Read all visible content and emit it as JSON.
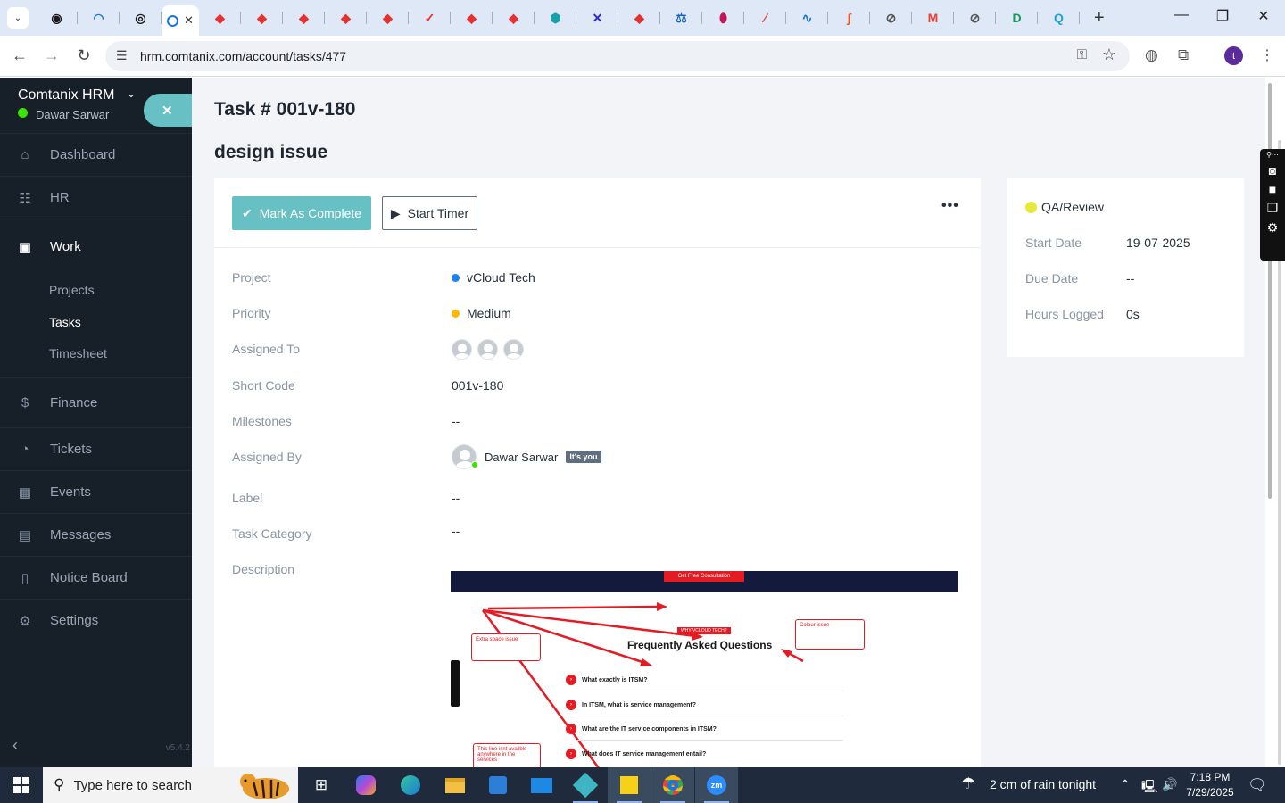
{
  "browser": {
    "url": "hrm.comtanix.com/account/tasks/477",
    "profile_initial": "t",
    "tabs": [
      {
        "color": "#1a1a1a",
        "glyph": "◉"
      },
      {
        "color": "#1a73e8",
        "glyph": "◠"
      },
      {
        "color": "#1a1a1a",
        "glyph": "◎"
      },
      {
        "color": "#ffffff",
        "glyph": "",
        "active": true
      },
      {
        "color": "#e8312f",
        "glyph": "◆"
      },
      {
        "color": "#e8312f",
        "glyph": "◆"
      },
      {
        "color": "#e8312f",
        "glyph": "◆"
      },
      {
        "color": "#e8312f",
        "glyph": "◆"
      },
      {
        "color": "#e8312f",
        "glyph": "◆"
      },
      {
        "color": "#e8312f",
        "glyph": "✓"
      },
      {
        "color": "#e8312f",
        "glyph": "◆"
      },
      {
        "color": "#e8312f",
        "glyph": "◆"
      },
      {
        "color": "#1aa1a8",
        "glyph": "⬢"
      },
      {
        "color": "#2c2cc8",
        "glyph": "✕"
      },
      {
        "color": "#e8312f",
        "glyph": "◆"
      },
      {
        "color": "#1565c0",
        "glyph": "⚖"
      },
      {
        "color": "#c2185b",
        "glyph": "⬮"
      },
      {
        "color": "#e53935",
        "glyph": "∕"
      },
      {
        "color": "#1976d2",
        "glyph": "∿"
      },
      {
        "color": "#f4511e",
        "glyph": "∫"
      },
      {
        "color": "#555555",
        "glyph": "⊘"
      },
      {
        "color": "#ea4335",
        "glyph": "M"
      },
      {
        "color": "#555555",
        "glyph": "⊘"
      },
      {
        "color": "#0f9d58",
        "glyph": "D"
      },
      {
        "color": "#1fa2d8",
        "glyph": "Q"
      }
    ]
  },
  "sidebar": {
    "company": "Comtanix HRM",
    "user": "Dawar Sarwar",
    "close_glyph": "✕",
    "items": [
      {
        "label": "Dashboard",
        "icon": "⌂"
      },
      {
        "label": "HR",
        "icon": "☷"
      },
      {
        "label": "Work",
        "icon": "▣",
        "active": true
      },
      {
        "label": "Finance",
        "icon": "$"
      },
      {
        "label": "Tickets",
        "icon": "◔"
      },
      {
        "label": "Events",
        "icon": "▦"
      },
      {
        "label": "Messages",
        "icon": "▤"
      },
      {
        "label": "Notice Board",
        "icon": "▯"
      },
      {
        "label": "Settings",
        "icon": "⚙"
      }
    ],
    "sub_items": [
      {
        "label": "Projects"
      },
      {
        "label": "Tasks",
        "active": true
      },
      {
        "label": "Timesheet"
      }
    ],
    "version": "v5.4.2"
  },
  "task": {
    "title": "Task # 001v-180",
    "heading": "design issue",
    "mark_complete": "Mark As Complete",
    "start_timer": "Start Timer",
    "more": "•••",
    "labels": {
      "project": "Project",
      "priority": "Priority",
      "assigned_to": "Assigned To",
      "short_code": "Short Code",
      "milestones": "Milestones",
      "assigned_by": "Assigned By",
      "label": "Label",
      "task_category": "Task Category",
      "description": "Description"
    },
    "values": {
      "project": "vCloud Tech",
      "project_color": "#1d82f5",
      "priority": "Medium",
      "priority_color": "#ffb800",
      "short_code": "001v-180",
      "milestones": "--",
      "assigned_by": "Dawar Sarwar",
      "its_you": "It's you",
      "label": "--",
      "task_category": "--"
    }
  },
  "description_image": {
    "cta": "Get Free Consultation",
    "tag": "WHY VCLOUD TECH?",
    "faq_title": "Frequently Asked Questions",
    "callout_left": "Extra space issue",
    "callout_right": "Colour issue",
    "callout_bottom": "This line isnt availble anywhere in the services",
    "questions": [
      "What exactly is ITSM?",
      "In ITSM, what is service management?",
      "What are the IT service components in ITSM?",
      "What does IT service management entail?"
    ]
  },
  "side": {
    "status": "QA/Review",
    "status_color": "#e6e83a",
    "start_date_label": "Start Date",
    "start_date": "19-07-2025",
    "due_date_label": "Due Date",
    "due_date": "--",
    "hours_label": "Hours Logged",
    "hours": "0s"
  },
  "taskbar": {
    "search_placeholder": "Type here to search",
    "weather": "2 cm of rain tonight",
    "time": "7:18 PM",
    "date": "7/29/2025"
  }
}
